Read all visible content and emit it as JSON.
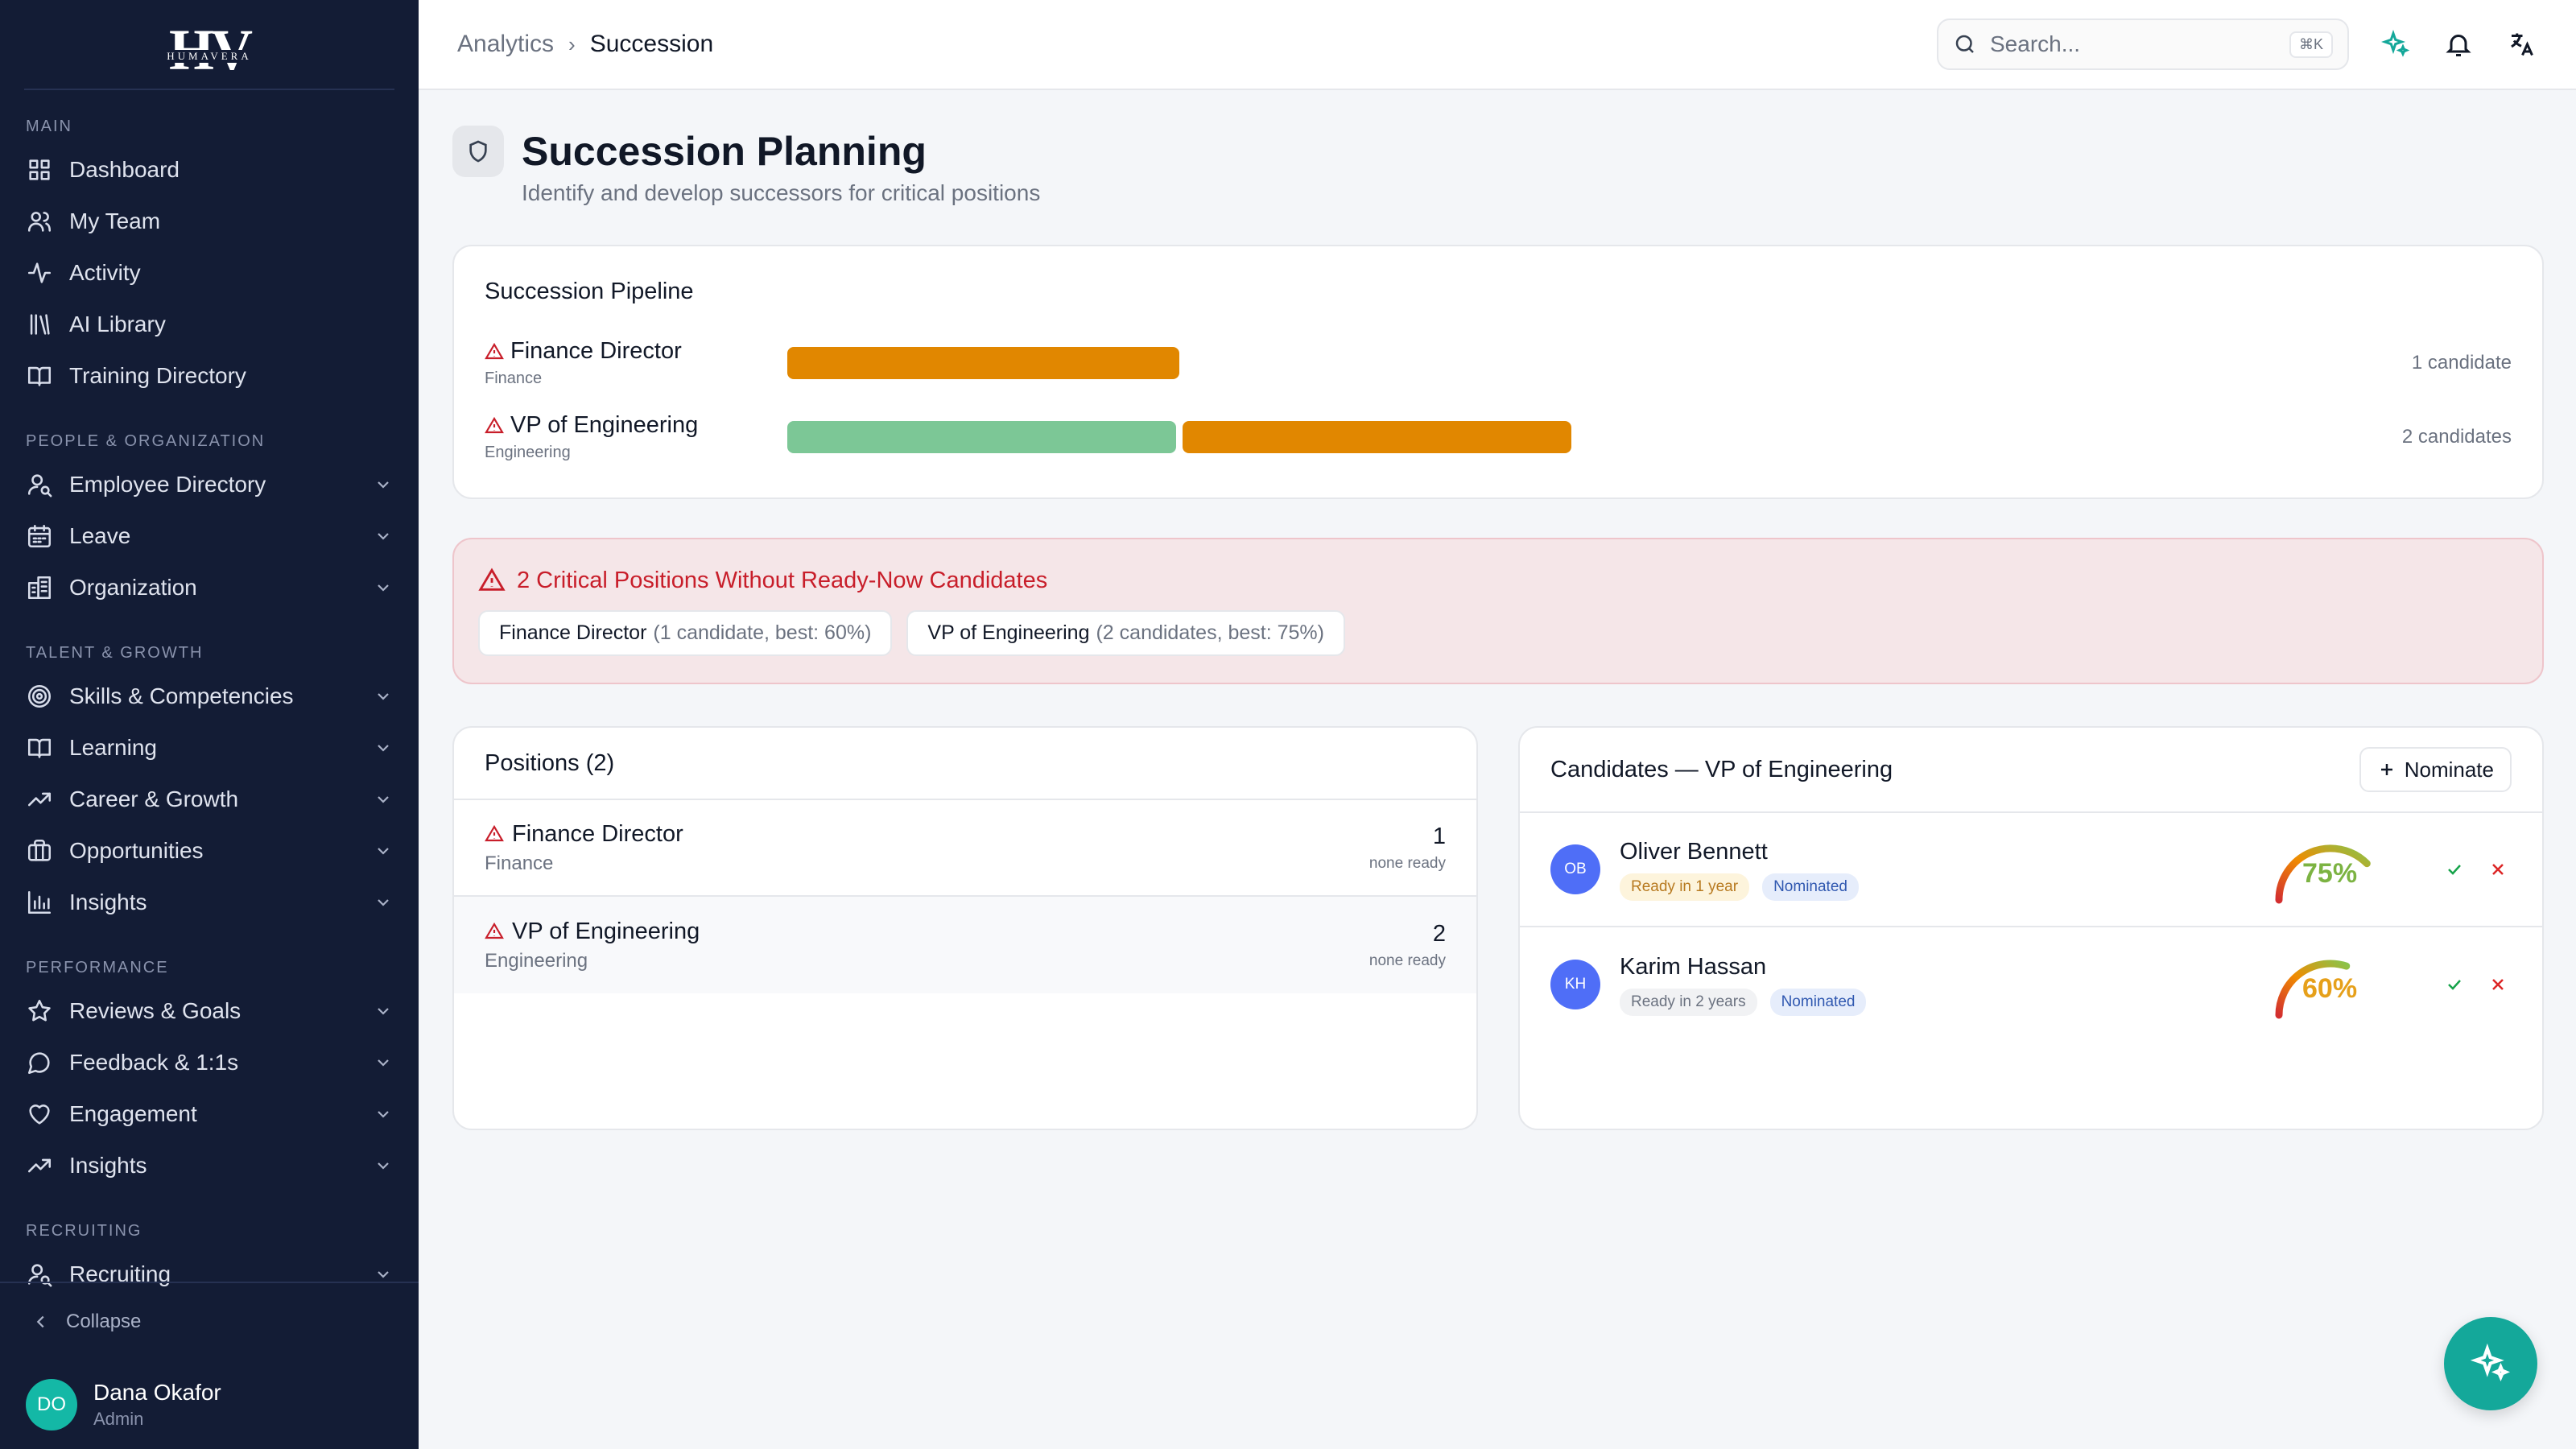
{
  "brand": {
    "mark": "HV",
    "word": "HUMAVERA"
  },
  "sidebar": {
    "sections": [
      {
        "title": "MAIN",
        "items": [
          {
            "label": "Dashboard",
            "icon": "grid-icon",
            "expandable": false
          },
          {
            "label": "My Team",
            "icon": "users-icon",
            "expandable": false
          },
          {
            "label": "Activity",
            "icon": "activity-icon",
            "expandable": false
          },
          {
            "label": "AI Library",
            "icon": "library-icon",
            "expandable": false
          },
          {
            "label": "Training Directory",
            "icon": "book-icon",
            "expandable": false
          }
        ]
      },
      {
        "title": "PEOPLE & ORGANIZATION",
        "items": [
          {
            "label": "Employee Directory",
            "icon": "user-search-icon",
            "expandable": true
          },
          {
            "label": "Leave",
            "icon": "calendar-icon",
            "expandable": true
          },
          {
            "label": "Organization",
            "icon": "building-icon",
            "expandable": true
          }
        ]
      },
      {
        "title": "TALENT & GROWTH",
        "items": [
          {
            "label": "Skills & Competencies",
            "icon": "target-icon",
            "expandable": true
          },
          {
            "label": "Learning",
            "icon": "book-icon",
            "expandable": true
          },
          {
            "label": "Career & Growth",
            "icon": "trending-up-icon",
            "expandable": true
          },
          {
            "label": "Opportunities",
            "icon": "briefcase-icon",
            "expandable": true
          },
          {
            "label": "Insights",
            "icon": "bar-chart-icon",
            "expandable": true
          }
        ]
      },
      {
        "title": "PERFORMANCE",
        "items": [
          {
            "label": "Reviews & Goals",
            "icon": "star-icon",
            "expandable": true
          },
          {
            "label": "Feedback & 1:1s",
            "icon": "message-icon",
            "expandable": true
          },
          {
            "label": "Engagement",
            "icon": "heart-icon",
            "expandable": true
          },
          {
            "label": "Insights",
            "icon": "trending-up-icon",
            "expandable": true
          }
        ]
      },
      {
        "title": "RECRUITING",
        "items": [
          {
            "label": "Recruiting",
            "icon": "user-search-icon",
            "expandable": true
          }
        ]
      }
    ],
    "collapse_label": "Collapse",
    "user": {
      "initials": "DO",
      "name": "Dana Okafor",
      "role": "Admin"
    }
  },
  "topbar": {
    "breadcrumb": [
      "Analytics",
      "Succession"
    ],
    "search_placeholder": "Search...",
    "search_shortcut": "⌘K"
  },
  "page": {
    "title": "Succession Planning",
    "subtitle": "Identify and develop successors for critical positions"
  },
  "pipeline": {
    "title": "Succession Pipeline",
    "rows": [
      {
        "name": "Finance Director",
        "dept": "Finance",
        "count_label": "1 candidate",
        "segments": [
          {
            "status": "ready-1-year",
            "color": "#e18700",
            "share": 0.117
          }
        ]
      },
      {
        "name": "VP of Engineering",
        "dept": "Engineering",
        "count_label": "2 candidates",
        "segments": [
          {
            "status": "ready-now",
            "color": "#7cc796",
            "share": 0.116
          },
          {
            "status": "ready-1-year",
            "color": "#e18700",
            "share": 0.116
          }
        ]
      }
    ]
  },
  "alert": {
    "title": "2 Critical Positions Without Ready-Now Candidates",
    "chips": [
      {
        "name": "Finance Director",
        "detail": "(1 candidate, best: 60%)"
      },
      {
        "name": "VP of Engineering",
        "detail": "(2 candidates, best: 75%)"
      }
    ]
  },
  "positions": {
    "title": "Positions (2)",
    "rows": [
      {
        "name": "Finance Director",
        "dept": "Finance",
        "count": "1",
        "ready": "none ready"
      },
      {
        "name": "VP of Engineering",
        "dept": "Engineering",
        "count": "2",
        "ready": "none ready"
      }
    ]
  },
  "candidates": {
    "title": "Candidates — VP of Engineering",
    "nominate_label": "Nominate",
    "rows": [
      {
        "initials": "OB",
        "name": "Oliver Bennett",
        "readiness": "Ready in 1 year",
        "status": "Nominated",
        "score": 75,
        "score_label": "75%",
        "score_color": "#7cb342",
        "readiness_style": "yellow"
      },
      {
        "initials": "KH",
        "name": "Karim Hassan",
        "readiness": "Ready in 2 years",
        "status": "Nominated",
        "score": 60,
        "score_label": "60%",
        "score_color": "#e6a01a",
        "readiness_style": "gray"
      }
    ]
  },
  "colors": {
    "sidebar": "#131c35",
    "accent": "#14a89a",
    "danger": "#c81e2a",
    "ready_now": "#7cc796",
    "ready_later": "#e18700"
  }
}
